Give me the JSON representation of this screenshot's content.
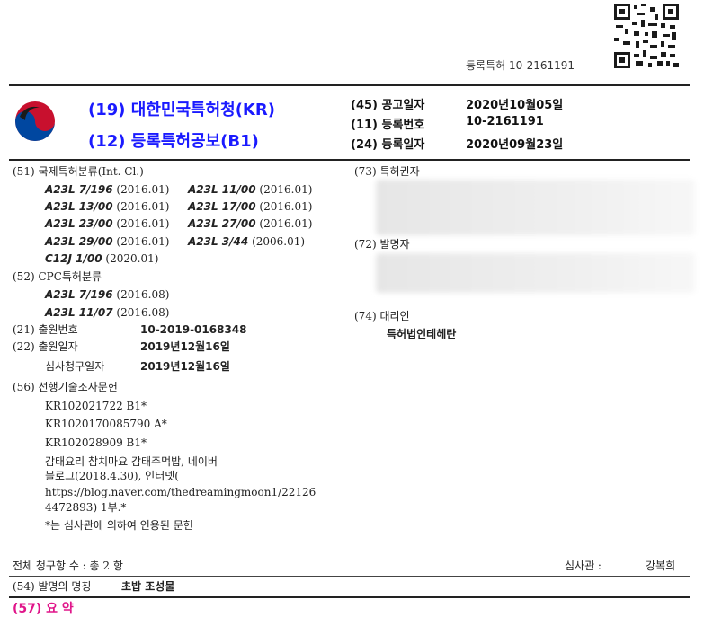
{
  "colors": {
    "title_blue": "#1a1aff",
    "abstract_magenta": "#e0168a",
    "rule": "#222222"
  },
  "header": {
    "reg_number_label": "등록특허 10-2161191",
    "office": "(19) 대한민국특허청(KR)",
    "doc_type": "(12) 등록특허공보(B1)",
    "pub_date_label": "(45) 공고일자",
    "pub_date_value": "2020년10월05일",
    "reg_no_label": "(11) 등록번호",
    "reg_no_value": "10-2161191",
    "reg_date_label": "(24) 등록일자",
    "reg_date_value": "2020년09월23일"
  },
  "ipc": {
    "label": "(51) 국제특허분류(Int. Cl.)",
    "rows": [
      [
        {
          "code": "A23L 7/196",
          "ver": "(2016.01)"
        },
        {
          "code": "A23L 11/00",
          "ver": "(2016.01)"
        }
      ],
      [
        {
          "code": "A23L 13/00",
          "ver": "(2016.01)"
        },
        {
          "code": "A23L 17/00",
          "ver": "(2016.01)"
        }
      ],
      [
        {
          "code": "A23L 23/00",
          "ver": "(2016.01)"
        },
        {
          "code": "A23L 27/00",
          "ver": "(2016.01)"
        }
      ],
      [
        {
          "code": "A23L 29/00",
          "ver": "(2016.01)"
        },
        {
          "code": "A23L 3/44",
          "ver": "(2006.01)"
        }
      ],
      [
        {
          "code": "C12J 1/00",
          "ver": "(2020.01)"
        }
      ]
    ]
  },
  "cpc": {
    "label": "(52) CPC특허분류",
    "rows": [
      {
        "code": "A23L 7/196",
        "ver": "(2016.08)"
      },
      {
        "code": "A23L 11/07",
        "ver": "(2016.08)"
      }
    ]
  },
  "application": {
    "app_no_label": "(21) 출원번호",
    "app_no_value": "10-2019-0168348",
    "app_date_label": "(22) 출원일자",
    "app_date_value": "2019년12월16일",
    "exam_req_label": "심사청구일자",
    "exam_req_value": "2019년12월16일"
  },
  "prior_art": {
    "label": "(56) 선행기술조사문헌",
    "items": [
      "KR102021722 B1*",
      "KR1020170085790 A*",
      "KR102028909 B1*",
      "감태요리 참치마요 감태주먹밥, 네이버",
      "블로그(2018.4.30), 인터넷(",
      "https://blog.naver.com/thedreamingmoon1/22126",
      "4472893) 1부.*",
      "*는 심사관에 의하여 인용된 문헌"
    ]
  },
  "right_col": {
    "patentee_label": "(73) 특허권자",
    "inventor_label": "(72) 발명자",
    "agent_label": "(74) 대리인",
    "agent_value": "특허법인테헤란"
  },
  "footer": {
    "claims_label": "전체 청구항 수 : 총  2  항",
    "examiner_label": "심사관 :",
    "examiner_name": "강복희",
    "title_label": "(54) 발명의 명칭",
    "title_value": "초밥 조성물",
    "abstract_label": "(57) 요 약"
  }
}
